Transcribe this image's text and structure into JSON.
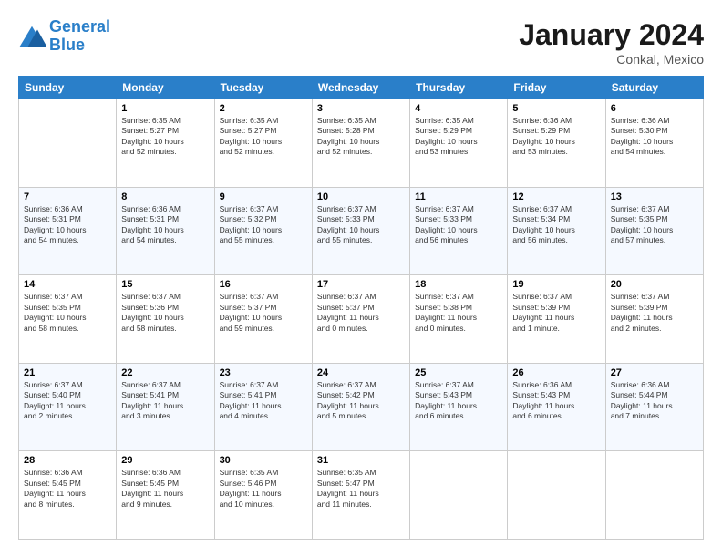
{
  "logo": {
    "line1": "General",
    "line2": "Blue"
  },
  "title": "January 2024",
  "location": "Conkal, Mexico",
  "weekdays": [
    "Sunday",
    "Monday",
    "Tuesday",
    "Wednesday",
    "Thursday",
    "Friday",
    "Saturday"
  ],
  "weeks": [
    [
      {
        "day": "",
        "info": ""
      },
      {
        "day": "1",
        "info": "Sunrise: 6:35 AM\nSunset: 5:27 PM\nDaylight: 10 hours\nand 52 minutes."
      },
      {
        "day": "2",
        "info": "Sunrise: 6:35 AM\nSunset: 5:27 PM\nDaylight: 10 hours\nand 52 minutes."
      },
      {
        "day": "3",
        "info": "Sunrise: 6:35 AM\nSunset: 5:28 PM\nDaylight: 10 hours\nand 52 minutes."
      },
      {
        "day": "4",
        "info": "Sunrise: 6:35 AM\nSunset: 5:29 PM\nDaylight: 10 hours\nand 53 minutes."
      },
      {
        "day": "5",
        "info": "Sunrise: 6:36 AM\nSunset: 5:29 PM\nDaylight: 10 hours\nand 53 minutes."
      },
      {
        "day": "6",
        "info": "Sunrise: 6:36 AM\nSunset: 5:30 PM\nDaylight: 10 hours\nand 54 minutes."
      }
    ],
    [
      {
        "day": "7",
        "info": "Sunrise: 6:36 AM\nSunset: 5:31 PM\nDaylight: 10 hours\nand 54 minutes."
      },
      {
        "day": "8",
        "info": "Sunrise: 6:36 AM\nSunset: 5:31 PM\nDaylight: 10 hours\nand 54 minutes."
      },
      {
        "day": "9",
        "info": "Sunrise: 6:37 AM\nSunset: 5:32 PM\nDaylight: 10 hours\nand 55 minutes."
      },
      {
        "day": "10",
        "info": "Sunrise: 6:37 AM\nSunset: 5:33 PM\nDaylight: 10 hours\nand 55 minutes."
      },
      {
        "day": "11",
        "info": "Sunrise: 6:37 AM\nSunset: 5:33 PM\nDaylight: 10 hours\nand 56 minutes."
      },
      {
        "day": "12",
        "info": "Sunrise: 6:37 AM\nSunset: 5:34 PM\nDaylight: 10 hours\nand 56 minutes."
      },
      {
        "day": "13",
        "info": "Sunrise: 6:37 AM\nSunset: 5:35 PM\nDaylight: 10 hours\nand 57 minutes."
      }
    ],
    [
      {
        "day": "14",
        "info": "Sunrise: 6:37 AM\nSunset: 5:35 PM\nDaylight: 10 hours\nand 58 minutes."
      },
      {
        "day": "15",
        "info": "Sunrise: 6:37 AM\nSunset: 5:36 PM\nDaylight: 10 hours\nand 58 minutes."
      },
      {
        "day": "16",
        "info": "Sunrise: 6:37 AM\nSunset: 5:37 PM\nDaylight: 10 hours\nand 59 minutes."
      },
      {
        "day": "17",
        "info": "Sunrise: 6:37 AM\nSunset: 5:37 PM\nDaylight: 11 hours\nand 0 minutes."
      },
      {
        "day": "18",
        "info": "Sunrise: 6:37 AM\nSunset: 5:38 PM\nDaylight: 11 hours\nand 0 minutes."
      },
      {
        "day": "19",
        "info": "Sunrise: 6:37 AM\nSunset: 5:39 PM\nDaylight: 11 hours\nand 1 minute."
      },
      {
        "day": "20",
        "info": "Sunrise: 6:37 AM\nSunset: 5:39 PM\nDaylight: 11 hours\nand 2 minutes."
      }
    ],
    [
      {
        "day": "21",
        "info": "Sunrise: 6:37 AM\nSunset: 5:40 PM\nDaylight: 11 hours\nand 2 minutes."
      },
      {
        "day": "22",
        "info": "Sunrise: 6:37 AM\nSunset: 5:41 PM\nDaylight: 11 hours\nand 3 minutes."
      },
      {
        "day": "23",
        "info": "Sunrise: 6:37 AM\nSunset: 5:41 PM\nDaylight: 11 hours\nand 4 minutes."
      },
      {
        "day": "24",
        "info": "Sunrise: 6:37 AM\nSunset: 5:42 PM\nDaylight: 11 hours\nand 5 minutes."
      },
      {
        "day": "25",
        "info": "Sunrise: 6:37 AM\nSunset: 5:43 PM\nDaylight: 11 hours\nand 6 minutes."
      },
      {
        "day": "26",
        "info": "Sunrise: 6:36 AM\nSunset: 5:43 PM\nDaylight: 11 hours\nand 6 minutes."
      },
      {
        "day": "27",
        "info": "Sunrise: 6:36 AM\nSunset: 5:44 PM\nDaylight: 11 hours\nand 7 minutes."
      }
    ],
    [
      {
        "day": "28",
        "info": "Sunrise: 6:36 AM\nSunset: 5:45 PM\nDaylight: 11 hours\nand 8 minutes."
      },
      {
        "day": "29",
        "info": "Sunrise: 6:36 AM\nSunset: 5:45 PM\nDaylight: 11 hours\nand 9 minutes."
      },
      {
        "day": "30",
        "info": "Sunrise: 6:35 AM\nSunset: 5:46 PM\nDaylight: 11 hours\nand 10 minutes."
      },
      {
        "day": "31",
        "info": "Sunrise: 6:35 AM\nSunset: 5:47 PM\nDaylight: 11 hours\nand 11 minutes."
      },
      {
        "day": "",
        "info": ""
      },
      {
        "day": "",
        "info": ""
      },
      {
        "day": "",
        "info": ""
      }
    ]
  ]
}
